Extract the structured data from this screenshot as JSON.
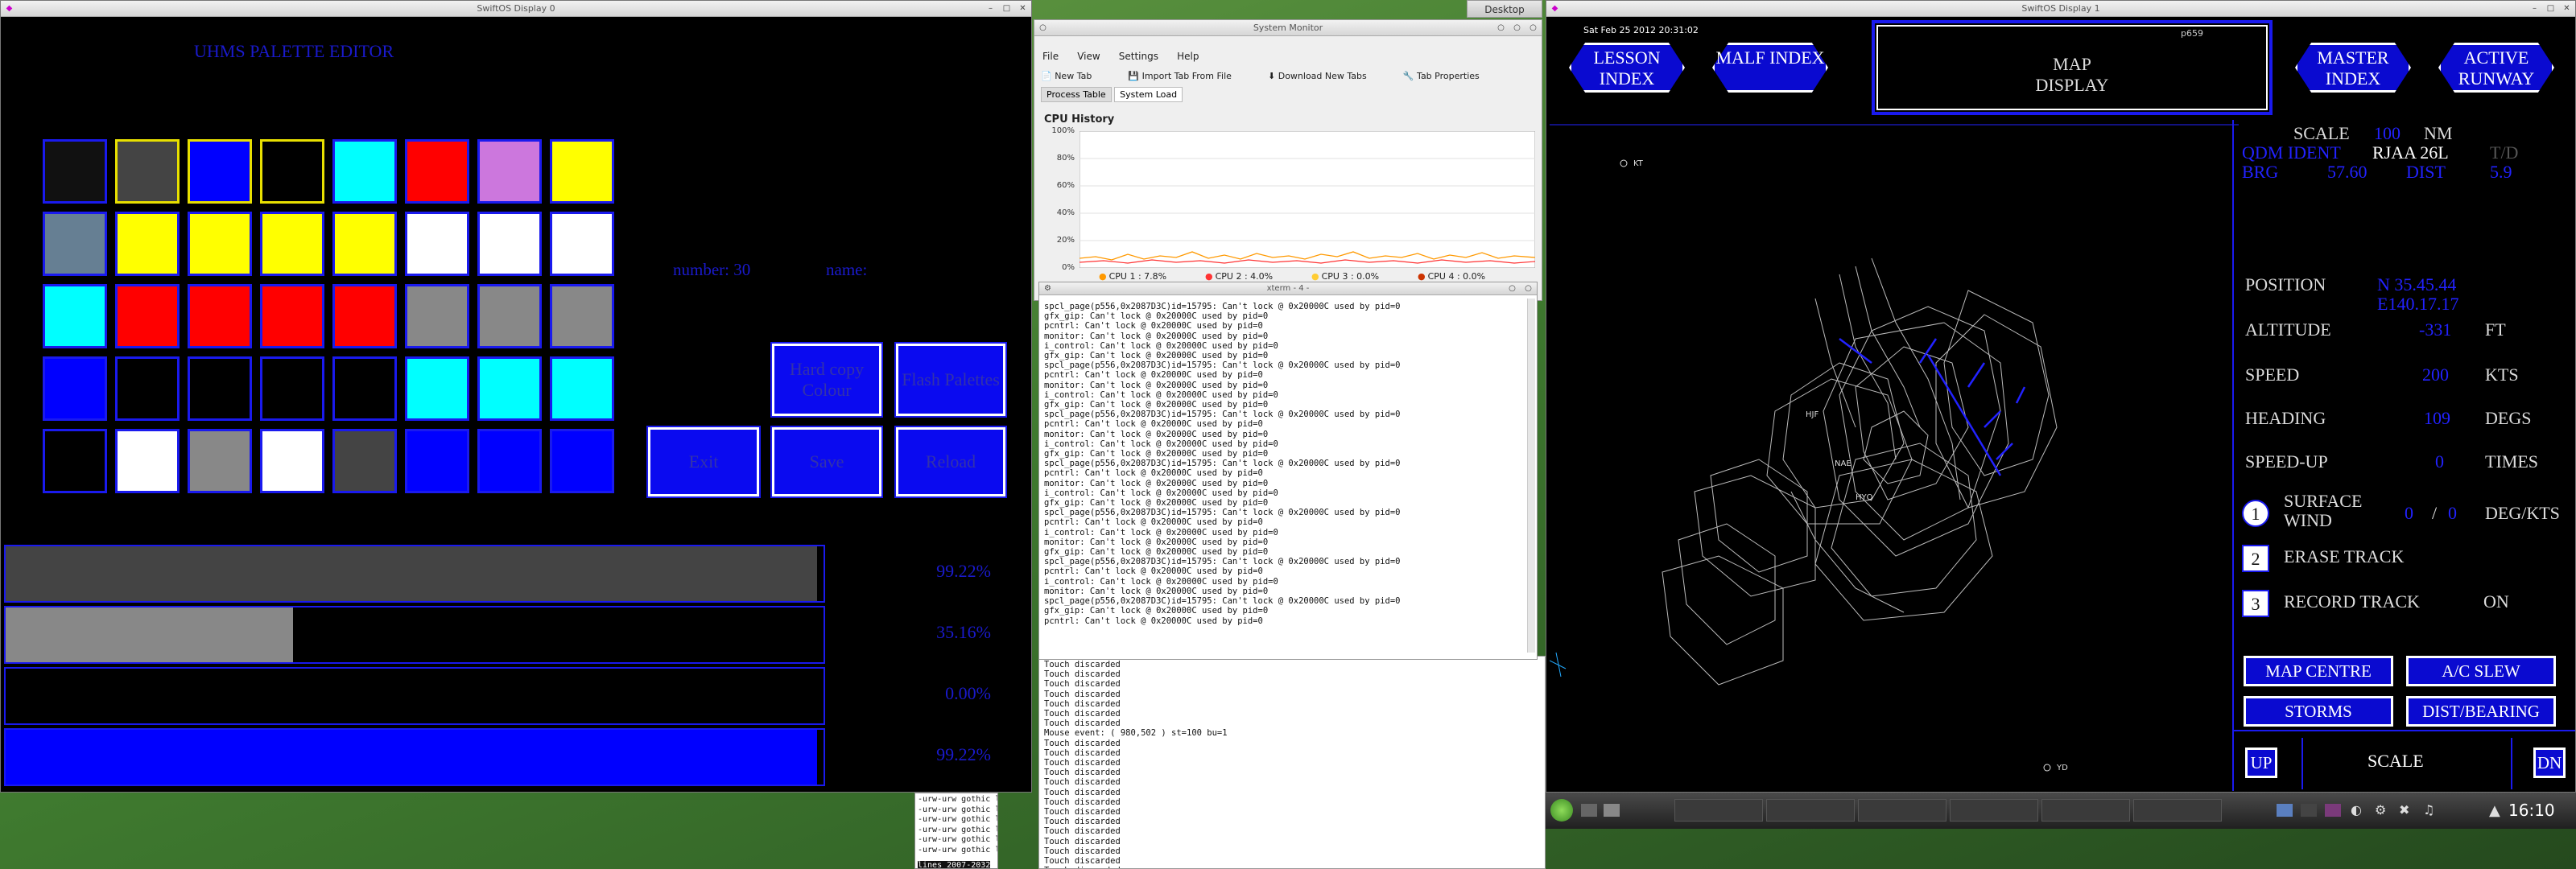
{
  "desktop": {
    "button": "Desktop"
  },
  "palette_window": {
    "title": "SwiftOS Display 0",
    "heading": "UHMS PALETTE EDITOR",
    "number_label": "number: 30",
    "name_label": "name:",
    "swatches": [
      [
        "#111111",
        "#444444",
        "#0000ff",
        "#000000",
        "#00ffff",
        "#ff0000",
        "#cc77dd",
        "#ffff00"
      ],
      [
        "#667f93",
        "#ffff00",
        "#ffff00",
        "#ffff00",
        "#ffff00",
        "#ffffff",
        "#ffffff",
        "#ffffff"
      ],
      [
        "#00ffff",
        "#ff0000",
        "#ff0000",
        "#ff0000",
        "#ff0000",
        "#888888",
        "#888888",
        "#888888"
      ],
      [
        "#0000ff",
        "#000000",
        "#000000",
        "#000000",
        "#000000",
        "#00ffff",
        "#00ffff",
        "#00ffff"
      ],
      [
        "#000000",
        "#ffffff",
        "#888888",
        "#ffffff",
        "#444444",
        "#0000ff",
        "#0000ff",
        "#0000ff"
      ]
    ],
    "buttons": {
      "hardcopy": "Hard copy Colour",
      "flash": "Flash Palettes",
      "exit": "Exit",
      "save": "Save",
      "reload": "Reload"
    },
    "channels": [
      {
        "pct": "99.22%",
        "fill": 0.9922,
        "color": "#444444"
      },
      {
        "pct": "35.16%",
        "fill": 0.3516,
        "color": "#888888"
      },
      {
        "pct": "0.00%",
        "fill": 0.0,
        "color": "#000000"
      },
      {
        "pct": "99.22%",
        "fill": 0.9922,
        "color": "#0000ff"
      }
    ]
  },
  "sysmon": {
    "title": "System Monitor",
    "menu": [
      "File",
      "View",
      "Settings",
      "Help"
    ],
    "toolbar": [
      "New Tab",
      "Import Tab From File",
      "Download New Tabs",
      "Tab Properties"
    ],
    "tabs": [
      "Process Table",
      "System Load"
    ],
    "section": "CPU History",
    "yticks": [
      "100%",
      "80%",
      "60%",
      "40%",
      "20%",
      "0%"
    ],
    "legend": [
      {
        "label": "CPU 1 : 7.8%",
        "color": "#ff9900"
      },
      {
        "label": "CPU 2 : 4.0%",
        "color": "#ff3333"
      },
      {
        "label": "CPU 3 : 0.0%",
        "color": "#ffcc33"
      },
      {
        "label": "CPU 4 : 0.0%",
        "color": "#cc3300"
      }
    ]
  },
  "terminal": {
    "title": "xterm - 4 -",
    "lines": [
      "spcl_page(p556,0x2087D3C)id=15795: Can't lock @ 0x20000C used by pid=0",
      "gfx_gip: Can't lock @ 0x20000C used by pid=0",
      "pcntrl: Can't lock @ 0x20000C used by pid=0",
      "monitor: Can't lock @ 0x20000C used by pid=0",
      "i_control: Can't lock @ 0x20000C used by pid=0",
      "gfx_gip: Can't lock @ 0x20000C used by pid=0",
      "spcl_page(p556,0x2087D3C)id=15795: Can't lock @ 0x20000C used by pid=0",
      "pcntrl: Can't lock @ 0x20000C used by pid=0",
      "monitor: Can't lock @ 0x20000C used by pid=0",
      "i_control: Can't lock @ 0x20000C used by pid=0",
      "gfx_gip: Can't lock @ 0x20000C used by pid=0",
      "spcl_page(p556,0x2087D3C)id=15795: Can't lock @ 0x20000C used by pid=0",
      "pcntrl: Can't lock @ 0x20000C used by pid=0",
      "monitor: Can't lock @ 0x20000C used by pid=0",
      "i_control: Can't lock @ 0x20000C used by pid=0",
      "gfx_gip: Can't lock @ 0x20000C used by pid=0",
      "spcl_page(p556,0x2087D3C)id=15795: Can't lock @ 0x20000C used by pid=0",
      "pcntrl: Can't lock @ 0x20000C used by pid=0",
      "monitor: Can't lock @ 0x20000C used by pid=0",
      "i_control: Can't lock @ 0x20000C used by pid=0",
      "gfx_gip: Can't lock @ 0x20000C used by pid=0",
      "spcl_page(p556,0x2087D3C)id=15795: Can't lock @ 0x20000C used by pid=0",
      "pcntrl: Can't lock @ 0x20000C used by pid=0",
      "i_control: Can't lock @ 0x20000C used by pid=0",
      "monitor: Can't lock @ 0x20000C used by pid=0",
      "gfx_gip: Can't lock @ 0x20000C used by pid=0",
      "spcl_page(p556,0x2087D3C)id=15795: Can't lock @ 0x20000C used by pid=0",
      "pcntrl: Can't lock @ 0x20000C used by pid=0",
      "i_control: Can't lock @ 0x20000C used by pid=0",
      "monitor: Can't lock @ 0x20000C used by pid=0",
      "spcl_page(p556,0x2087D3C)id=15795: Can't lock @ 0x20000C used by pid=0",
      "gfx_gip: Can't lock @ 0x20000C used by pid=0",
      "pcntrl: Can't lock @ 0x20000C used by pid=0"
    ]
  },
  "touchlog": {
    "lines": [
      "Touch discarded",
      "Touch discarded",
      "Touch discarded",
      "Touch discarded",
      "Touch discarded",
      "Touch discarded",
      "Touch discarded",
      "Mouse event: ( 980,502 ) st=100 bu=1",
      "Touch discarded",
      "Touch discarded",
      "Touch discarded",
      "Touch discarded",
      "Touch discarded",
      "Touch discarded",
      "Touch discarded",
      "Touch discarded",
      "Touch discarded",
      "Touch discarded",
      "Touch discarded",
      "Touch discarded",
      "Touch discarded",
      "Touch discarded",
      "Touch discarded",
      "Touch discarded"
    ]
  },
  "filelist": {
    "lines": [
      "-urw-urw gothic l-medium",
      "-urw-urw gothic l-medium",
      "-urw-urw gothic l-medium",
      "-urw-urw gothic l-medium",
      "-urw-urw gothic l-medium",
      "-urw-urw gothic l-medium"
    ],
    "status": "lines 2007-2032"
  },
  "map_window": {
    "title": "SwiftOS Display 1",
    "datetime": "Sat Feb 25 2012 20:31:02",
    "corner_code": "p659",
    "nav": {
      "lesson": "LESSON INDEX",
      "malf": "MALF INDEX",
      "master": "MASTER INDEX",
      "active": "ACTIVE RUNWAY"
    },
    "map_display": "MAP DISPLAY",
    "map_labels": [
      "KT",
      "HJF",
      "NAE",
      "HYQ",
      "YD"
    ],
    "scale_label": "SCALE",
    "scale_value": "100",
    "scale_unit": "NM",
    "qdm_label": "QDM IDENT",
    "qdm_value": "RJAA 26L",
    "td_label": "T/D",
    "brg_label": "BRG",
    "brg_value": "57.60",
    "dist_label": "DIST",
    "dist_value": "5.9",
    "position_label": "POSITION",
    "position_lat": "N 35.45.44",
    "position_lon": "E140.17.17",
    "altitude_label": "ALTITUDE",
    "altitude_value": "-331",
    "altitude_unit": "FT",
    "speed_label": "SPEED",
    "speed_value": "200",
    "speed_unit": "KTS",
    "heading_label": "HEADING",
    "heading_value": "109",
    "heading_unit": "DEGS",
    "speedup_label": "SPEED-UP",
    "speedup_value": "0",
    "speedup_unit": "TIMES",
    "wind_num": "1",
    "wind_label": "SURFACE WIND",
    "wind_dir": "0",
    "wind_sep": "/",
    "wind_speed": "0",
    "wind_unit": "DEG/KTS",
    "erase_num": "2",
    "erase_label": "ERASE TRACK",
    "record_num": "3",
    "record_label": "RECORD TRACK",
    "record_value": "ON",
    "buttons": {
      "map_centre": "MAP CENTRE",
      "ac_slew": "A/C SLEW",
      "storms": "STORMS",
      "dist_bearing": "DIST/BEARING",
      "up": "UP",
      "dn": "DN"
    },
    "scale_footer": "SCALE"
  },
  "taskbar": {
    "clock": "16:10"
  }
}
